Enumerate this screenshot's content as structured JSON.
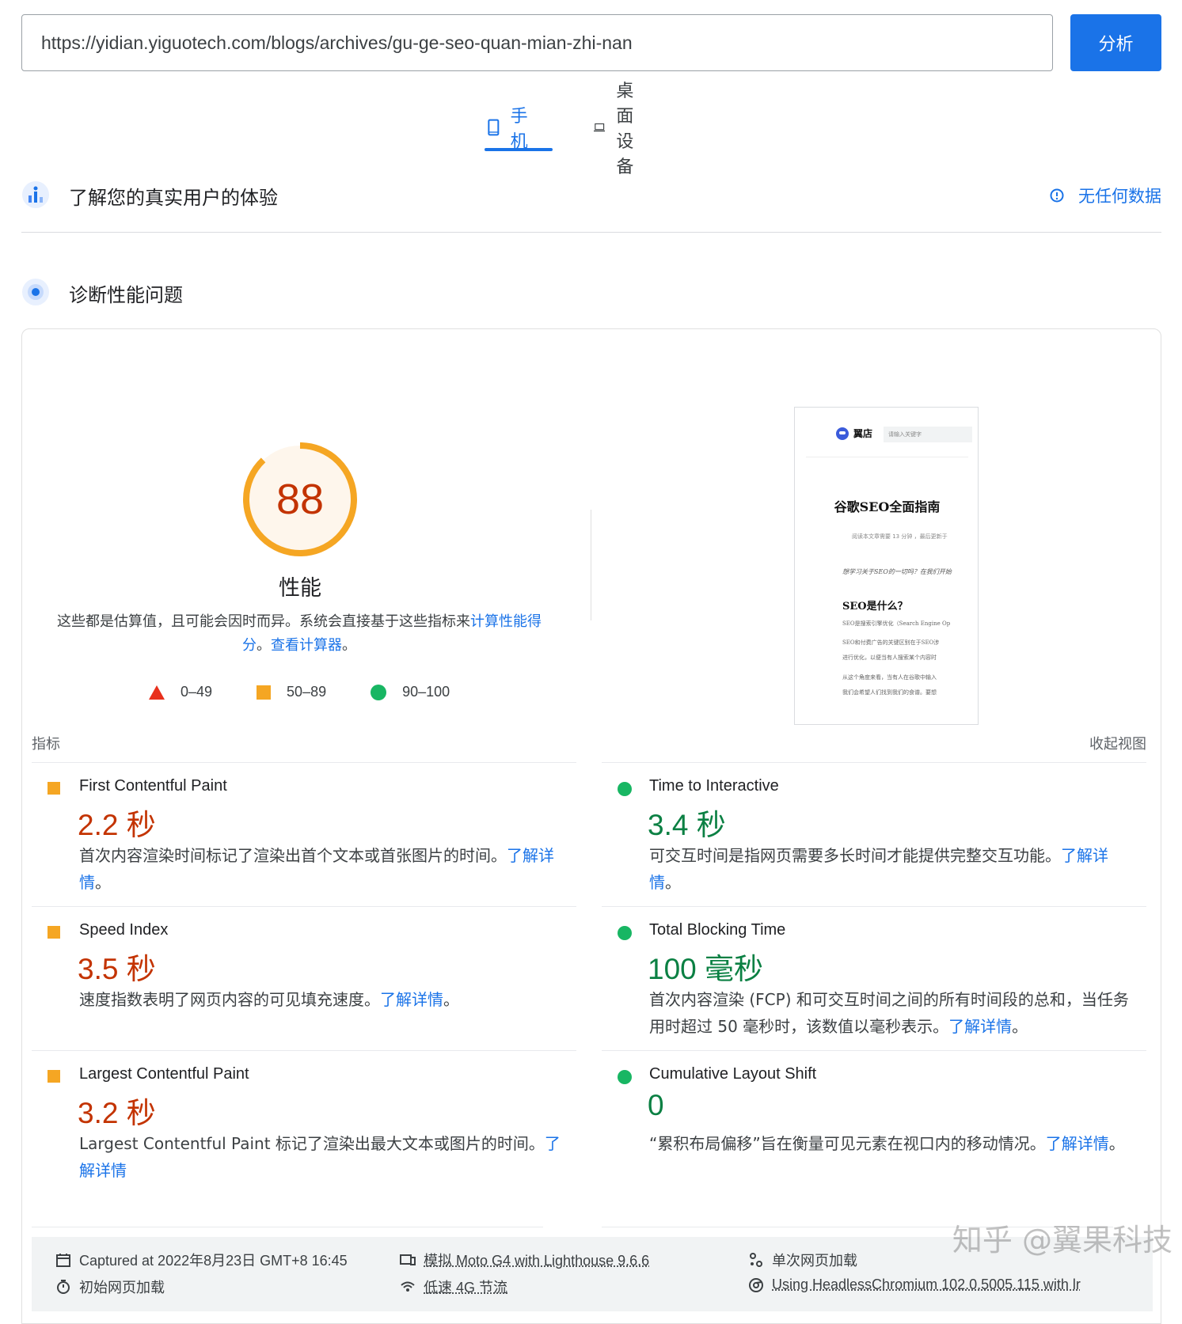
{
  "url_bar": {
    "value": "https://yidian.yiguotech.com/blogs/archives/gu-ge-seo-quan-mian-zhi-nan",
    "button": "分析"
  },
  "tabs": [
    {
      "label": "手机",
      "active": true,
      "icon": "mobile-phone-icon"
    },
    {
      "label": "桌面设备",
      "active": false,
      "icon": "laptop-icon"
    }
  ],
  "crux": {
    "title": "了解您的真实用户的体验",
    "status": "无任何数据",
    "icon": "users-chart-icon",
    "status_icon": "info-icon"
  },
  "diagnose": {
    "title": "诊断性能问题",
    "icon": "lighthouse-icon"
  },
  "performance": {
    "score": "88",
    "score_value": 0.88,
    "score_color": "#f5a623",
    "label": "性能",
    "desc_prefix": "这些都是估算值，且可能会因时而异。系统会直接基于这些指标来",
    "desc_link1": "计算性能得分",
    "desc_mid": "。",
    "desc_link2": "查看计算器",
    "desc_end": "。"
  },
  "legend": [
    {
      "label": "0–49",
      "color": "#e8301c"
    },
    {
      "label": "50–89",
      "color": "#f5a623"
    },
    {
      "label": "90–100",
      "color": "#18b663"
    }
  ],
  "thumbnail": {
    "brand": "翼店",
    "search_placeholder": "请输入关键字",
    "title": "谷歌SEO全面指南",
    "meta": "阅读本文章需要 13 分钟 ，最后更新于",
    "intro": "想学习关于SEO的一切吗？在我们开始",
    "h2": "SEO是什么？",
    "lines": [
      "SEO是搜索引擎优化（Search Engine Op",
      "SEO和付费广告的关键区别在于SEO涉",
      "进行优化，以便当有人搜索某个内容时",
      "从这个角度来看，当有人在谷歌中输入",
      "我们会希望人们找到我们的食谱。要想"
    ]
  },
  "metrics": {
    "header_left": "指标",
    "header_right": "收起视图",
    "items": [
      {
        "name": "First Contentful Paint",
        "value": "2.2 秒",
        "status": "average",
        "desc": "首次内容渲染时间标记了渲染出首个文本或首张图片的时间。",
        "link": "了解详情",
        "end": "。"
      },
      {
        "name": "Time to Interactive",
        "value": "3.4 秒",
        "status": "good",
        "desc": "可交互时间是指网页需要多长时间才能提供完整交互功能。",
        "link": "了解详情",
        "end": "。"
      },
      {
        "name": "Speed Index",
        "value": "3.5 秒",
        "status": "average",
        "desc": "速度指数表明了网页内容的可见填充速度。",
        "link": "了解详情",
        "end": "。"
      },
      {
        "name": "Total Blocking Time",
        "value": "100 毫秒",
        "status": "good",
        "desc": "首次内容渲染 (FCP) 和可交互时间之间的所有时间段的总和，当任务用时超过 50 毫秒时，该数值以毫秒表示。",
        "link": "了解详情",
        "end": "。"
      },
      {
        "name": "Largest Contentful Paint",
        "value": "3.2 秒",
        "status": "average",
        "desc": "Largest Contentful Paint 标记了渲染出最大文本或图片的时间。",
        "link": "了解详情",
        "end": ""
      },
      {
        "name": "Cumulative Layout Shift",
        "value": "0",
        "status": "good",
        "desc": "“累积布局偏移”旨在衡量可见元素在视口内的移动情况。",
        "link": "了解详情",
        "end": "。"
      }
    ]
  },
  "footer": {
    "captured": "Captured at 2022年8月23日 GMT+8 16:45",
    "initial_load": "初始网页加载",
    "device": "模拟 Moto G4 with Lighthouse 9.6.6",
    "throttle": "低速 4G 节流",
    "single_load": "单次网页加载",
    "browser": "Using HeadlessChromium 102.0.5005.115 with lr"
  },
  "watermark": "知乎 @翼果科技"
}
